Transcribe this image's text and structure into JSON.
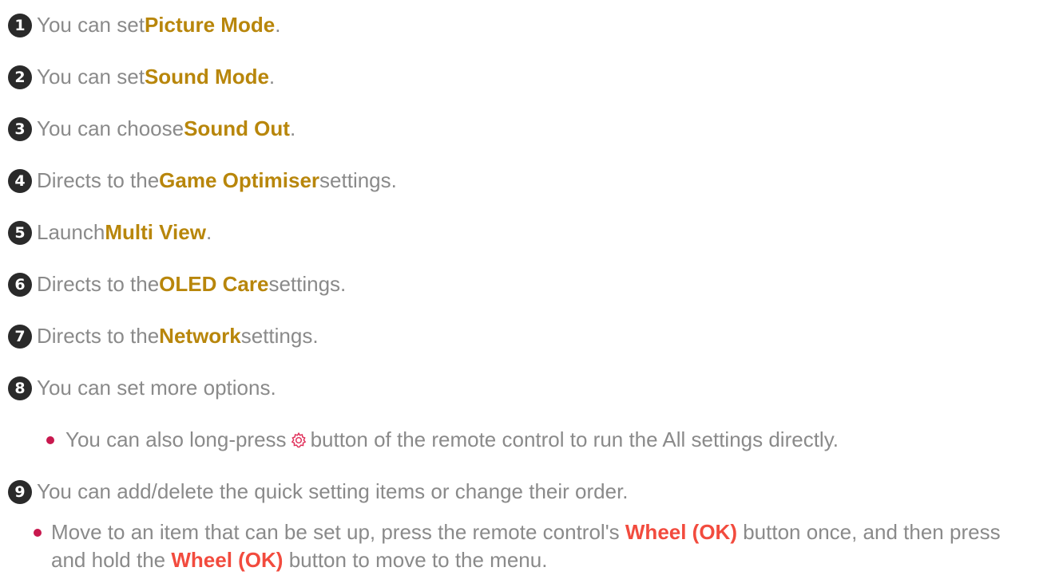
{
  "items": [
    {
      "num": "1",
      "pre": "You can set ",
      "bold": "Picture Mode",
      "post": "."
    },
    {
      "num": "2",
      "pre": "You can set ",
      "bold": "Sound Mode",
      "post": "."
    },
    {
      "num": "3",
      "pre": "You can choose ",
      "bold": "Sound Out",
      "post": "."
    },
    {
      "num": "4",
      "pre": "Directs to the ",
      "bold": "Game Optimiser",
      "post": " settings."
    },
    {
      "num": "5",
      "pre": "Launch ",
      "bold": "Multi View",
      "post": "."
    },
    {
      "num": "6",
      "pre": "Directs to the ",
      "bold": "OLED Care",
      "post": " settings."
    },
    {
      "num": "7",
      "pre": "Directs to the ",
      "bold": "Network",
      "post": " settings."
    },
    {
      "num": "8",
      "text": "You can set more options."
    },
    {
      "num": "9",
      "text": "You can add/delete the quick setting items or change their order."
    }
  ],
  "sub_note": {
    "pre": "You can also long-press ",
    "icon": "gear-icon",
    "post": " button of the remote control to run the All settings directly."
  },
  "note": {
    "part1": "Move to an item that can be set up, press the remote control's ",
    "bold1": "Wheel (OK)",
    "part2": " button once, and then press and hold the ",
    "bold2": "Wheel (OK)",
    "part3": " button to move to the menu."
  },
  "colors": {
    "body_text": "#8a8a8a",
    "highlight": "#b8860b",
    "highlight_red": "#f24b3e",
    "bullet": "#c8184e",
    "number_badge": "#2a2a2a"
  }
}
